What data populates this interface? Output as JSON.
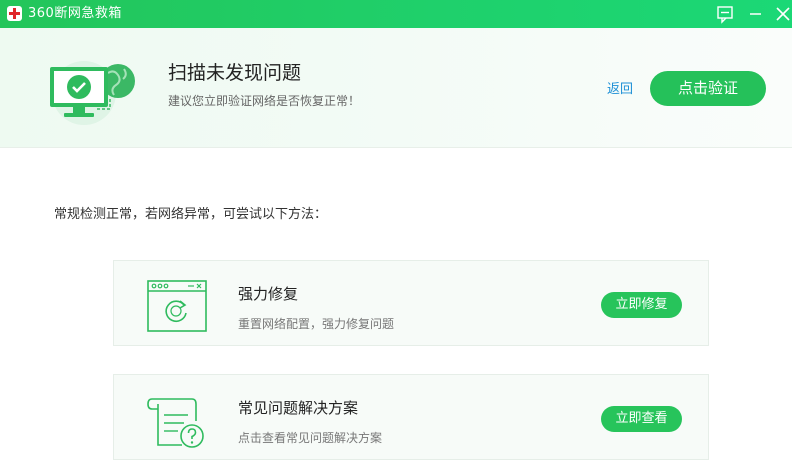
{
  "window": {
    "title": "360断网急救箱",
    "icons": [
      "app-logo-icon",
      "feedback-icon",
      "minimize-icon",
      "close-icon"
    ]
  },
  "header": {
    "title": "扫描未发现问题",
    "subtitle": "建议您立即验证网络是否恢复正常！",
    "back_label": "返回",
    "verify_label": "点击验证",
    "icon": "monitor-check-globe-icon"
  },
  "main": {
    "hint": "常规检测正常，若网络异常，可尝试以下方法：",
    "options": [
      {
        "title": "强力修复",
        "desc": "重置网络配置，强力修复问题",
        "button": "立即修复",
        "icon": "browser-refresh-icon"
      },
      {
        "title": "常见问题解决方案",
        "desc": "点击查看常见问题解决方案",
        "button": "立即查看",
        "icon": "document-help-icon"
      }
    ]
  },
  "colors": {
    "titlebar": "#22c85e",
    "accent": "#25c15a",
    "link": "#1c8fd6"
  }
}
